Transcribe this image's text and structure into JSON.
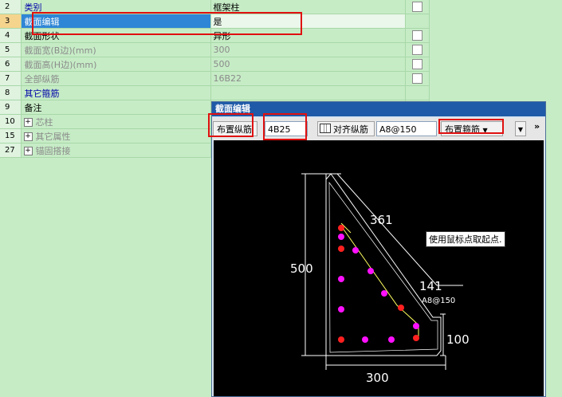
{
  "rows": [
    {
      "num": "2",
      "name": "类别",
      "name_style": "blue",
      "value": "框架柱",
      "checkbox": true,
      "expander": false
    },
    {
      "num": "3",
      "name": "截面编辑",
      "name_style": "selected",
      "value": "是",
      "checkbox": false,
      "expander": false
    },
    {
      "num": "4",
      "name": "截面形状",
      "name_style": "black",
      "value": "异形",
      "checkbox": true,
      "expander": false
    },
    {
      "num": "5",
      "name": "截面宽(B边)(mm)",
      "name_style": "gray",
      "value": "300",
      "checkbox": true,
      "expander": false
    },
    {
      "num": "6",
      "name": "截面高(H边)(mm)",
      "name_style": "gray",
      "value": "500",
      "checkbox": true,
      "expander": false
    },
    {
      "num": "7",
      "name": "全部纵筋",
      "name_style": "gray",
      "value": "16B22",
      "checkbox": true,
      "expander": false
    },
    {
      "num": "8",
      "name": "其它箍筋",
      "name_style": "blue",
      "value": "",
      "checkbox": false,
      "expander": false
    },
    {
      "num": "9",
      "name": "备注",
      "name_style": "black",
      "value": "",
      "checkbox": false,
      "expander": false
    },
    {
      "num": "10",
      "name": "芯柱",
      "name_style": "gray",
      "value": "",
      "checkbox": false,
      "expander": true
    },
    {
      "num": "15",
      "name": "其它属性",
      "name_style": "gray",
      "value": "",
      "checkbox": false,
      "expander": true
    },
    {
      "num": "27",
      "name": "锚固搭接",
      "name_style": "gray",
      "value": "",
      "checkbox": false,
      "expander": true
    }
  ],
  "dialog": {
    "title": "截面编辑",
    "toolbar": {
      "place_longitudinal": "布置纵筋",
      "longitudinal_value": "4B25",
      "align_longitudinal": "对齐纵筋",
      "stirrup_value": "A8@150",
      "place_stirrup": "布置箍筋",
      "more": "»"
    },
    "tooltip": "使用鼠标点取起点.",
    "dimensions": {
      "height": "500",
      "diagonal": "361",
      "notch_width": "141",
      "stirrup_label": "A8@150",
      "notch_height": "100",
      "width": "300"
    }
  },
  "colors": {
    "rebar_corner": "#ff2020",
    "rebar_middle": "#ff10ff",
    "outline": "#ffffff",
    "stirrup": "#ffff60",
    "highlight": "#e01010"
  }
}
